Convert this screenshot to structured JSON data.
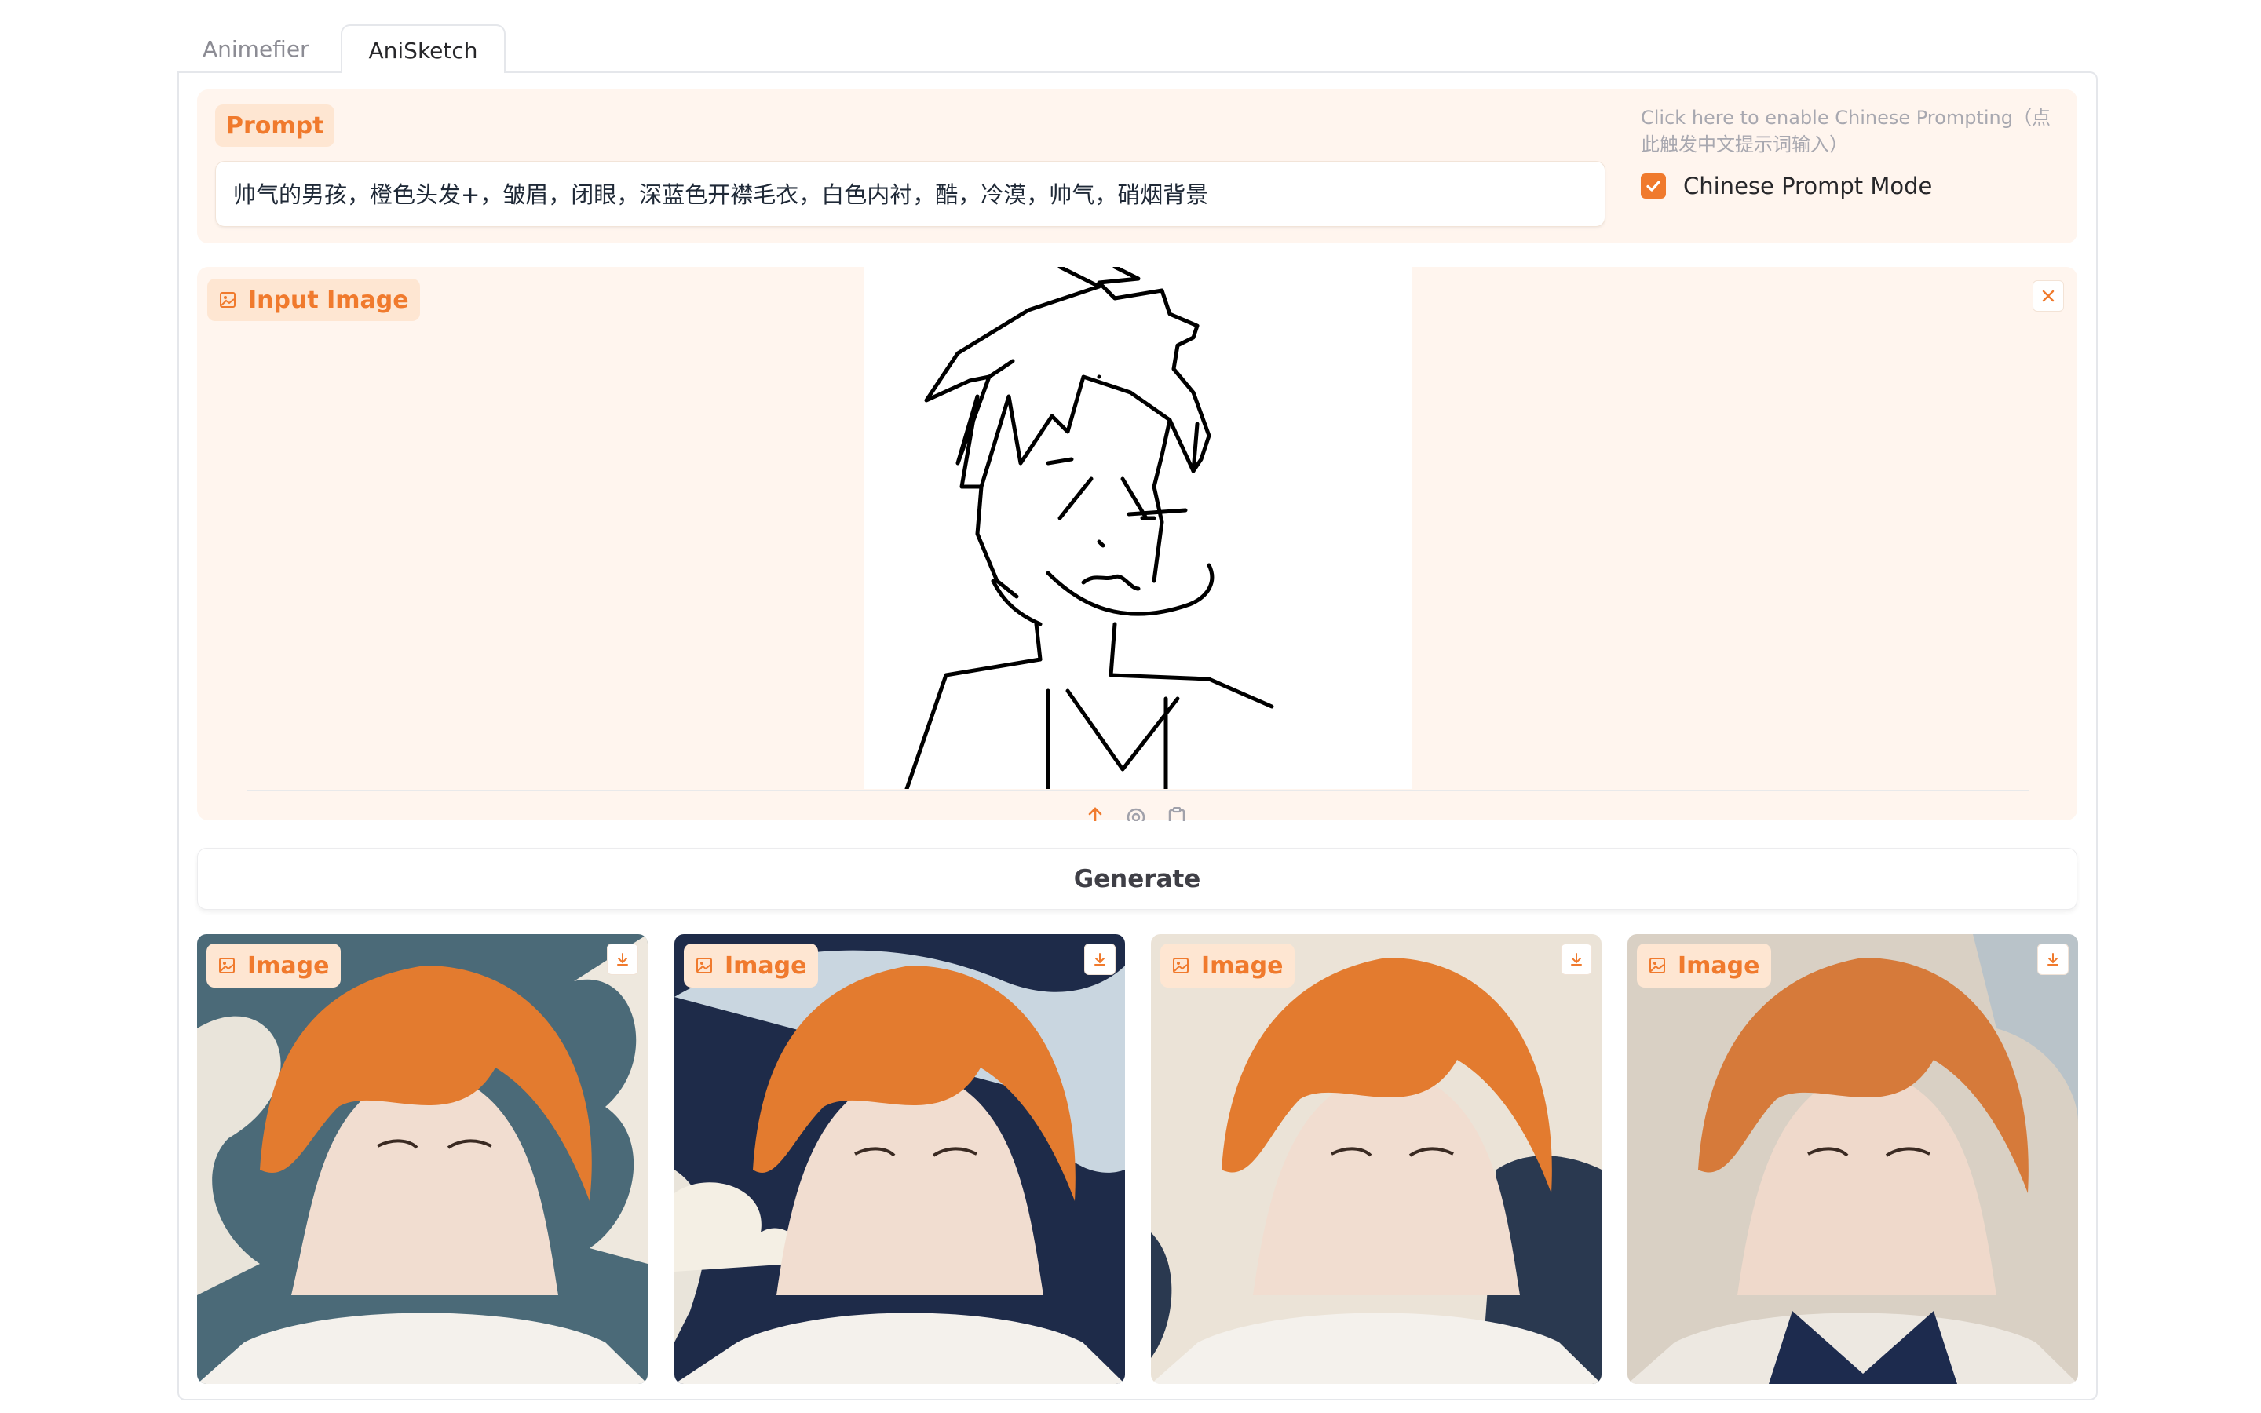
{
  "tabs": [
    {
      "label": "Animefier",
      "active": false
    },
    {
      "label": "AniSketch",
      "active": true
    }
  ],
  "prompt": {
    "label": "Prompt",
    "value": "帅气的男孩，橙色头发+，皱眉，闭眼，深蓝色开襟毛衣，白色内衬，酷，冷漠，帅气，硝烟背景"
  },
  "chinese_mode": {
    "hint": "Click here to enable Chinese Prompting（点此触发中文提示词输入）",
    "label": "Chinese Prompt Mode",
    "checked": true
  },
  "input_image": {
    "label": "Input Image",
    "icons": [
      "image-icon",
      "close-icon",
      "upload-icon",
      "webcam-icon",
      "clipboard-icon"
    ]
  },
  "generate": {
    "label": "Generate"
  },
  "outputs": [
    {
      "label": "Image",
      "bg": "#4a6a7a"
    },
    {
      "label": "Image",
      "bg": "#1c2a4a"
    },
    {
      "label": "Image",
      "bg": "#e8e0d4"
    },
    {
      "label": "Image",
      "bg": "#d8cfc4"
    }
  ],
  "colors": {
    "accent": "#f07a2d",
    "panel_bg": "#fff5ee",
    "chip_bg": "#fee6d2"
  }
}
